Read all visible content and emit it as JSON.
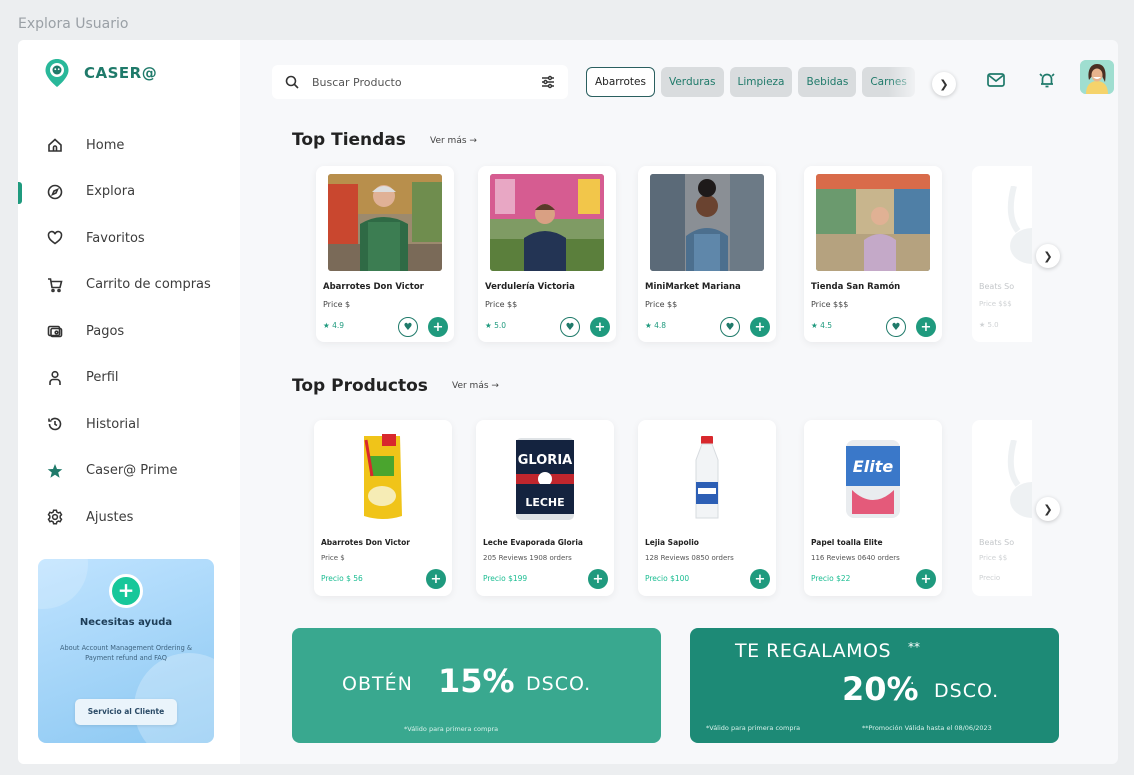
{
  "window": {
    "title": "Explora Usuario"
  },
  "brand": {
    "name": "CASER@",
    "accent": "#1f9a7e"
  },
  "sidebar": {
    "items": [
      {
        "label": "Home",
        "icon": "home-icon"
      },
      {
        "label": "Explora",
        "icon": "compass-icon",
        "active": true
      },
      {
        "label": "Favoritos",
        "icon": "heart-icon"
      },
      {
        "label": "Carrito de compras",
        "icon": "cart-icon"
      },
      {
        "label": "Pagos",
        "icon": "wallet-icon"
      },
      {
        "label": "Perfil",
        "icon": "user-icon"
      },
      {
        "label": "Historial",
        "icon": "history-icon"
      },
      {
        "label": "Caser@ Prime",
        "icon": "star-icon"
      },
      {
        "label": "Ajustes",
        "icon": "gear-icon"
      }
    ],
    "help": {
      "title": "Necesitas ayuda",
      "description": "About Account Management Ordering & Payment refund and FAQ",
      "button": "Servicio al Cliente"
    }
  },
  "search": {
    "placeholder": "Buscar Producto"
  },
  "categories": [
    {
      "label": "Abarrotes",
      "active": true
    },
    {
      "label": "Verduras",
      "active": false
    },
    {
      "label": "Limpieza",
      "active": false
    },
    {
      "label": "Bebidas",
      "active": false
    },
    {
      "label": "Carnes",
      "active": false
    }
  ],
  "top_stores": {
    "title": "Top Tiendas",
    "see_more": "Ver más →",
    "items": [
      {
        "name": "Abarrotes Don Victor",
        "price": "Price $",
        "rating": "★ 4.9"
      },
      {
        "name": "Verdulería Victoria",
        "price": "Price $$",
        "rating": "★ 5.0"
      },
      {
        "name": "MiniMarket Mariana",
        "price": "Price $$",
        "rating": "★ 4.8"
      },
      {
        "name": "Tienda San Ramón",
        "price": "Price $$$",
        "rating": "★ 4.5"
      }
    ],
    "partial": {
      "name": "Beats So",
      "price": "Price $$$",
      "rating": "★ 5.0"
    }
  },
  "top_products": {
    "title": "Top Productos",
    "see_more": "Ver más →",
    "items": [
      {
        "name": "Abarrotes Don Victor",
        "sub": "Price $",
        "price": "Precio $ 56"
      },
      {
        "name": "Leche Evaporada Gloria",
        "sub": "205 Reviews  1908 orders",
        "price": "Precio $199"
      },
      {
        "name": "Lejia Sapolio",
        "sub": "128 Reviews  0850 orders",
        "price": "Precio $100"
      },
      {
        "name": "Papel toalla Elite",
        "sub": "116 Reviews  0640 orders",
        "price": "Precio $22"
      }
    ],
    "partial": {
      "name": "Beats So",
      "sub": "Price $$",
      "price": "Precio"
    },
    "brand_labels": {
      "gloria": "GLORIA",
      "leche": "LECHE",
      "elite": "Elite"
    }
  },
  "promos": [
    {
      "prefix": "OBTÉN",
      "percent": "15%",
      "suffix": "DSCO.",
      "note": "*Válido para primera compra"
    },
    {
      "title": "TE REGALAMOS",
      "marks": "**",
      "percent": "20%",
      "suffix": "DSCO.",
      "note1": "*Válido para primera compra",
      "note2": "**Promoción Válida hasta el 08/06/2023"
    }
  ]
}
